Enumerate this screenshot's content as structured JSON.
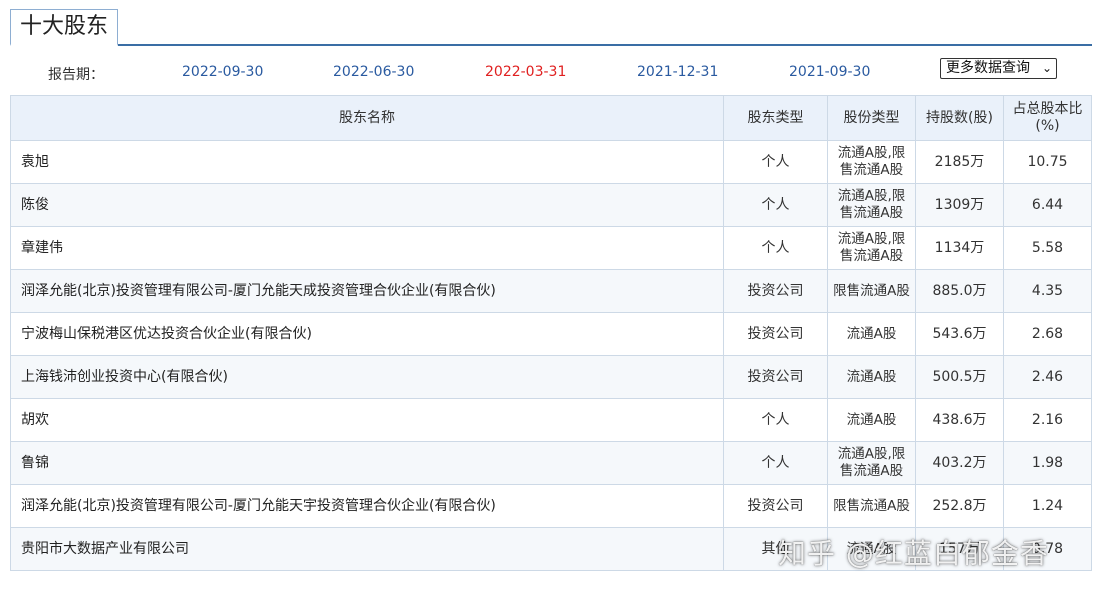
{
  "section": {
    "title": "十大股东"
  },
  "period": {
    "label": "报告期：",
    "dates": [
      "2022-09-30",
      "2022-06-30",
      "2022-03-31",
      "2021-12-31",
      "2021-09-30"
    ],
    "active_index": 2,
    "more_query": "更多数据查询"
  },
  "colors": {
    "active_date": "#e02020",
    "link_date": "#2a5aa0",
    "header_bg": "#eaf1fa",
    "accent_line": "#3a6ea5"
  },
  "table": {
    "headers": {
      "name": "股东名称",
      "holder_type": "股东类型",
      "share_type": "股份类型",
      "shares": "持股数(股)",
      "ratio_line1": "占总股本比",
      "ratio_line2": "(%)"
    },
    "rows": [
      {
        "name": "袁旭",
        "holder_type": "个人",
        "share_type_1": "流通A股,限",
        "share_type_2": "售流通A股",
        "shares": "2185万",
        "ratio": "10.75"
      },
      {
        "name": "陈俊",
        "holder_type": "个人",
        "share_type_1": "流通A股,限",
        "share_type_2": "售流通A股",
        "shares": "1309万",
        "ratio": "6.44"
      },
      {
        "name": "章建伟",
        "holder_type": "个人",
        "share_type_1": "流通A股,限",
        "share_type_2": "售流通A股",
        "shares": "1134万",
        "ratio": "5.58"
      },
      {
        "name": "润泽允能(北京)投资管理有限公司-厦门允能天成投资管理合伙企业(有限合伙)",
        "holder_type": "投资公司",
        "share_type_1": "限售流通A股",
        "share_type_2": "",
        "shares": "885.0万",
        "ratio": "4.35"
      },
      {
        "name": "宁波梅山保税港区优达投资合伙企业(有限合伙)",
        "holder_type": "投资公司",
        "share_type_1": "流通A股",
        "share_type_2": "",
        "shares": "543.6万",
        "ratio": "2.68"
      },
      {
        "name": "上海钱沛创业投资中心(有限合伙)",
        "holder_type": "投资公司",
        "share_type_1": "流通A股",
        "share_type_2": "",
        "shares": "500.5万",
        "ratio": "2.46"
      },
      {
        "name": "胡欢",
        "holder_type": "个人",
        "share_type_1": "流通A股",
        "share_type_2": "",
        "shares": "438.6万",
        "ratio": "2.16"
      },
      {
        "name": "鲁锦",
        "holder_type": "个人",
        "share_type_1": "流通A股,限",
        "share_type_2": "售流通A股",
        "shares": "403.2万",
        "ratio": "1.98"
      },
      {
        "name": "润泽允能(北京)投资管理有限公司-厦门允能天宇投资管理合伙企业(有限合伙)",
        "holder_type": "投资公司",
        "share_type_1": "限售流通A股",
        "share_type_2": "",
        "shares": "252.8万",
        "ratio": "1.24"
      },
      {
        "name": "贵阳市大数据产业有限公司",
        "holder_type": "其他",
        "share_type_1": "流通A股",
        "share_type_2": "",
        "shares": "157万",
        "ratio": "0.78"
      }
    ]
  },
  "watermark": "知乎 @红蓝白郁金香"
}
